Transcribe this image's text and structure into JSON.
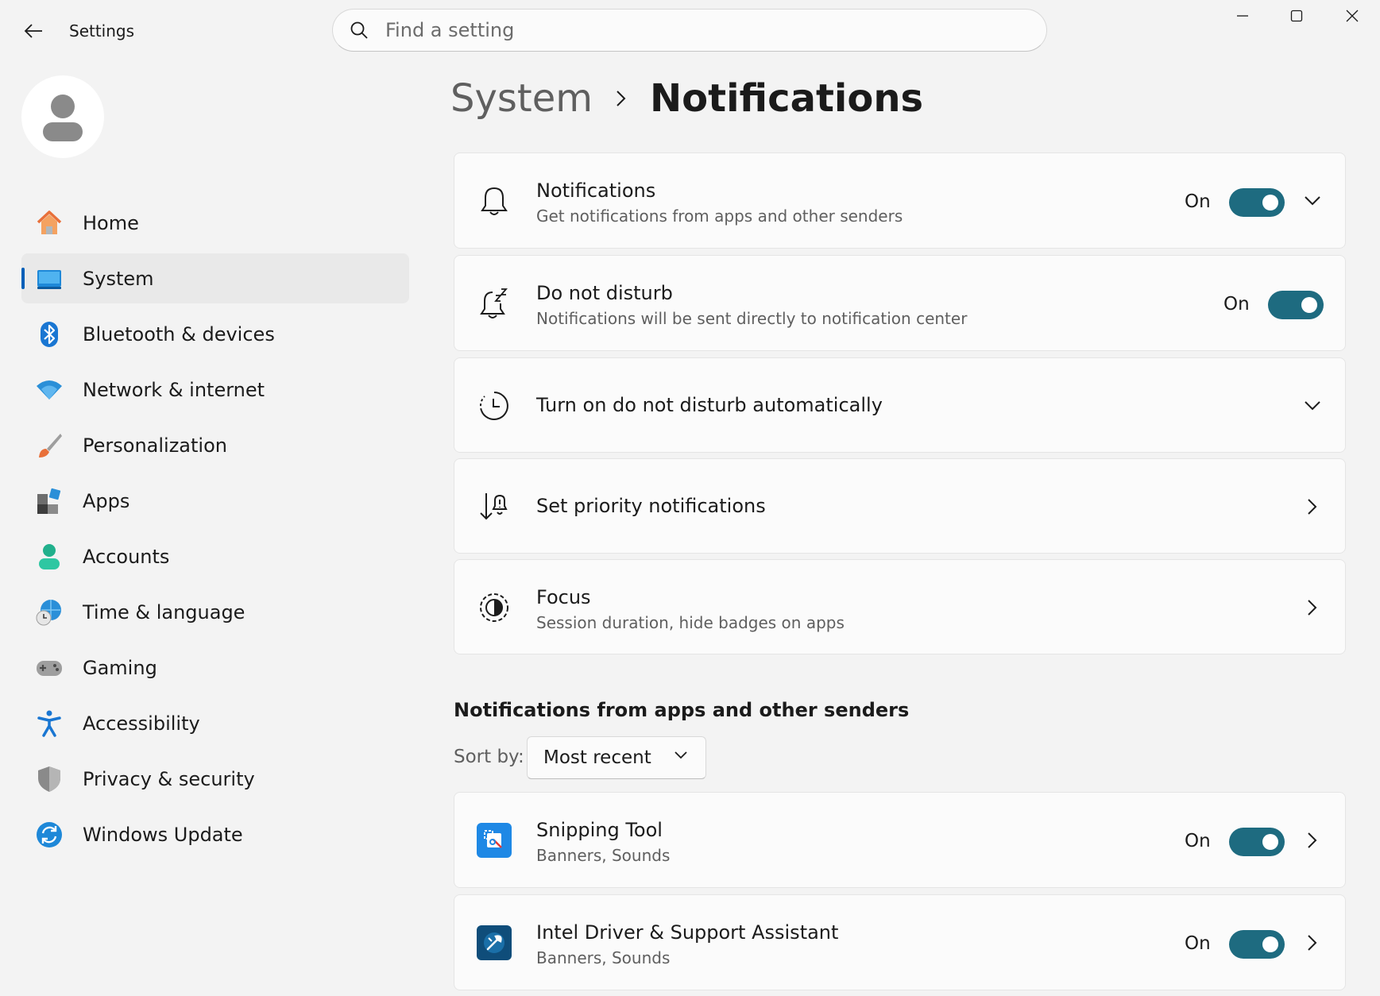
{
  "window": {
    "title": "Settings",
    "minimize_icon": "minimize-icon",
    "maximize_icon": "maximize-icon",
    "close_icon": "close-icon"
  },
  "search": {
    "placeholder": "Find a setting"
  },
  "sidebar": {
    "items": [
      {
        "label": "Home",
        "icon": "home-icon",
        "active": false
      },
      {
        "label": "System",
        "icon": "system-icon",
        "active": true
      },
      {
        "label": "Bluetooth & devices",
        "icon": "bluetooth-icon",
        "active": false
      },
      {
        "label": "Network & internet",
        "icon": "wifi-icon",
        "active": false
      },
      {
        "label": "Personalization",
        "icon": "brush-icon",
        "active": false
      },
      {
        "label": "Apps",
        "icon": "apps-icon",
        "active": false
      },
      {
        "label": "Accounts",
        "icon": "accounts-icon",
        "active": false
      },
      {
        "label": "Time & language",
        "icon": "globe-clock-icon",
        "active": false
      },
      {
        "label": "Gaming",
        "icon": "gamepad-icon",
        "active": false
      },
      {
        "label": "Accessibility",
        "icon": "accessibility-icon",
        "active": false
      },
      {
        "label": "Privacy & security",
        "icon": "shield-icon",
        "active": false
      },
      {
        "label": "Windows Update",
        "icon": "update-icon",
        "active": false
      }
    ]
  },
  "breadcrumb": {
    "parent": "System",
    "current": "Notifications"
  },
  "cards": {
    "notifications": {
      "title": "Notifications",
      "subtitle": "Get notifications from apps and other senders",
      "state": "On"
    },
    "dnd": {
      "title": "Do not disturb",
      "subtitle": "Notifications will be sent directly to notification center",
      "state": "On"
    },
    "auto_dnd": {
      "title": "Turn on do not disturb automatically"
    },
    "priority": {
      "title": "Set priority notifications"
    },
    "focus": {
      "title": "Focus",
      "subtitle": "Session duration, hide badges on apps"
    }
  },
  "apps_section": {
    "heading": "Notifications from apps and other senders",
    "sort_label": "Sort by:",
    "sort_value": "Most recent",
    "apps": [
      {
        "name": "Snipping Tool",
        "subtitle": "Banners, Sounds",
        "state": "On",
        "icon": "snipping-tool-icon"
      },
      {
        "name": "Intel Driver & Support Assistant",
        "subtitle": "Banners, Sounds",
        "state": "On",
        "icon": "intel-dsa-icon"
      }
    ]
  },
  "colors": {
    "accent": "#005fb8",
    "toggle_on": "#1e6b80",
    "background": "#f3f3f3",
    "card": "#fbfbfb"
  }
}
